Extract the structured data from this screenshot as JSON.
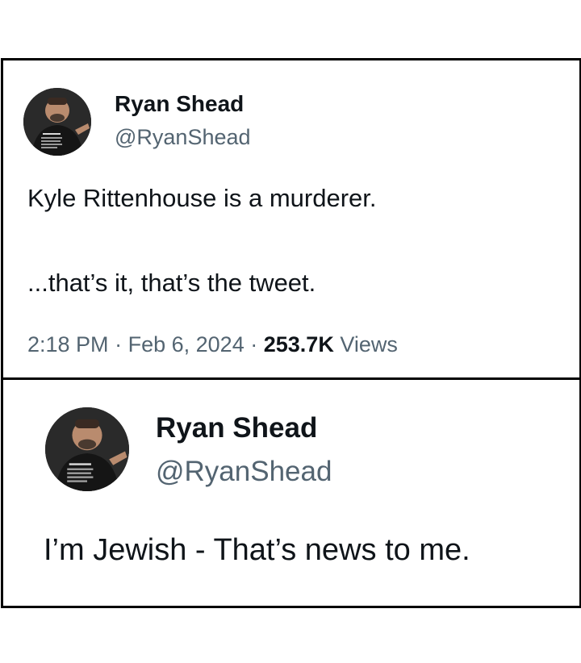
{
  "tweet_main": {
    "author_name": "Ryan Shead",
    "author_handle": "@RyanShead",
    "text_line1": "Kyle Rittenhouse is a murderer.",
    "text_line2": "...that’s it, that’s the tweet.",
    "time": "2:18 PM",
    "separator": "·",
    "date": "Feb 6, 2024",
    "views_count": "253.7K",
    "views_label": "Views"
  },
  "tweet_reply": {
    "author_name": "Ryan Shead",
    "author_handle": "@RyanShead",
    "text": "I’m Jewish - That’s news to me."
  },
  "colors": {
    "text_primary": "#0f1419",
    "text_secondary": "#536471",
    "border": "#000000",
    "thread_line": "#cfd9de"
  },
  "icons": {
    "avatar": "profile-photo"
  }
}
